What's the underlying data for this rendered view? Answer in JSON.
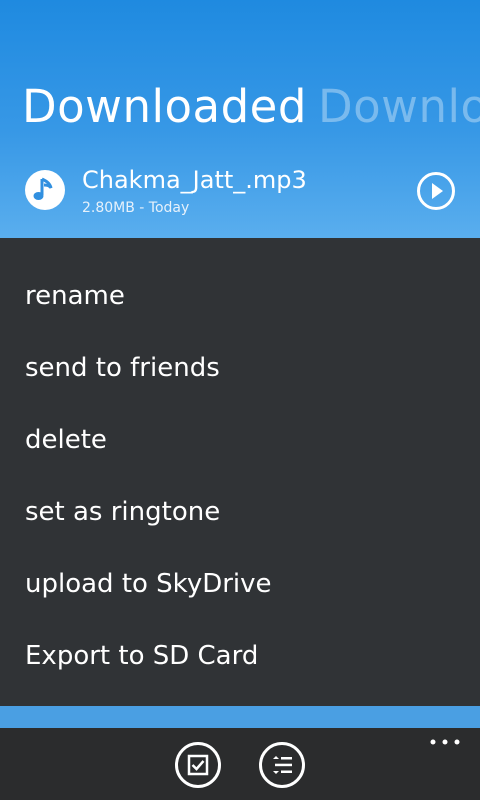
{
  "pivot": {
    "current_title": "Downloaded",
    "next_title": "Downlo"
  },
  "file": {
    "name": "Chakma_Jatt_.mp3",
    "meta": "2.80MB - Today",
    "icon": "music-note-icon"
  },
  "context_menu": {
    "items": [
      {
        "label": "rename"
      },
      {
        "label": "send to friends"
      },
      {
        "label": "delete"
      },
      {
        "label": "set as ringtone"
      },
      {
        "label": "upload to SkyDrive"
      },
      {
        "label": "Export to SD Card"
      }
    ]
  },
  "app_bar": {
    "buttons": [
      "select-checkbox-icon",
      "list-options-icon"
    ],
    "more": "ellipsis-icon"
  },
  "colors": {
    "accent_blue": "#1f8ae0",
    "menu_background": "#303336",
    "app_bar_background": "#2b2c2d",
    "text": "#ffffff"
  }
}
